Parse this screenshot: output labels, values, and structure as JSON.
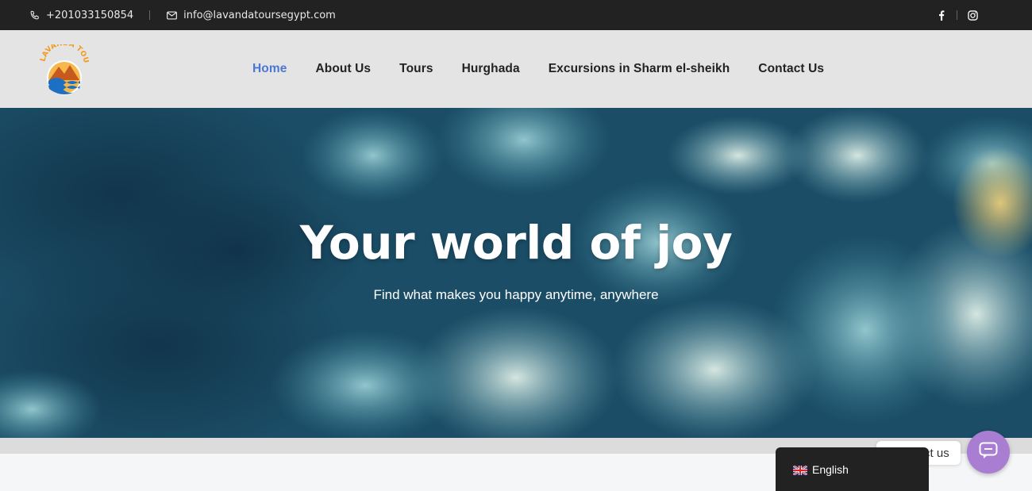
{
  "topbar": {
    "phone": "+201033150854",
    "email": "info@lavandatoursegypt.com",
    "icons": [
      "phone-icon",
      "mail-icon",
      "facebook-icon",
      "instagram-icon"
    ]
  },
  "brand": {
    "logo_text": "LAVANDA TOURS"
  },
  "nav": {
    "items": [
      {
        "label": "Home",
        "active": true
      },
      {
        "label": "About Us"
      },
      {
        "label": "Tours"
      },
      {
        "label": "Hurghada"
      },
      {
        "label": "Excursions in Sharm el-sheikh"
      },
      {
        "label": "Contact Us"
      }
    ]
  },
  "hero": {
    "title": "Your world of joy",
    "subtitle": "Find what makes you happy anytime, anywhere"
  },
  "chat": {
    "label": "Contact us"
  },
  "language": {
    "current": "English"
  },
  "colors": {
    "topbar": "#222222",
    "header": "#e4e4e4",
    "nav_active": "#4a78d4",
    "chat_button": "#a97ed2"
  }
}
